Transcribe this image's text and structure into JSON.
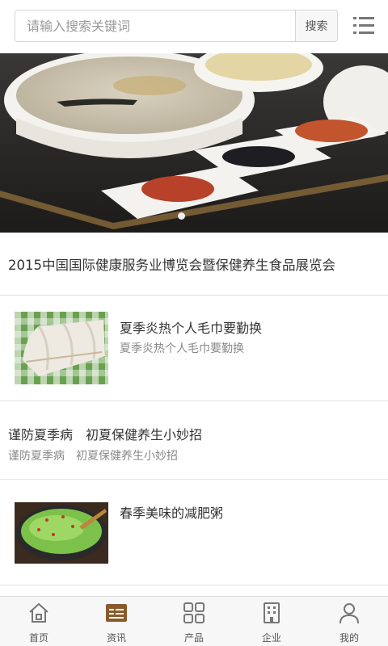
{
  "search": {
    "placeholder": "请输入搜索关键词",
    "button_label": "搜索"
  },
  "icons": {
    "menu": "menu-list-icon",
    "home": "home-icon",
    "news": "news-icon",
    "products": "grid-icon",
    "company": "building-icon",
    "profile": "user-icon"
  },
  "banner": {
    "image_desc": "banner-image",
    "active_dot": 1
  },
  "headline": {
    "title": "2015中国国际健康服务业博览会暨保健养生食品展览会"
  },
  "news_items": [
    {
      "title": "夏季炎热个人毛巾要勤换",
      "subtitle": "夏季炎热个人毛巾要勤换"
    },
    {
      "title": "谨防夏季病　初夏保健养生小妙招",
      "subtitle": "谨防夏季病　初夏保健养生小妙招"
    },
    {
      "title": "春季美味的减肥粥",
      "subtitle": ""
    }
  ],
  "bottom_nav": [
    {
      "label": "首页"
    },
    {
      "label": "资讯"
    },
    {
      "label": "产品"
    },
    {
      "label": "企业"
    },
    {
      "label": "我的"
    }
  ],
  "colors": {
    "accent": "#8a5a2b",
    "nav_icon": "#777777",
    "text": "#333333",
    "subtext": "#888888",
    "divider": "#e2e2e2"
  }
}
